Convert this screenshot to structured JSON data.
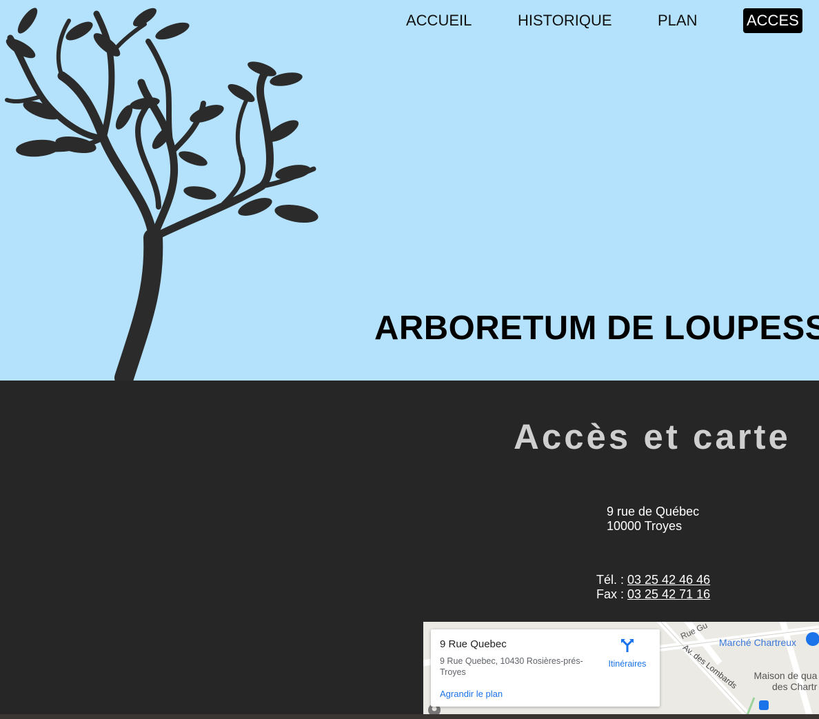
{
  "nav": {
    "items": [
      {
        "label": "ACCUEIL"
      },
      {
        "label": "HISTORIQUE"
      },
      {
        "label": "PLAN"
      },
      {
        "label": "ACCES",
        "active": true
      }
    ]
  },
  "hero": {
    "title": "ARBORETUM DE LOUPESS",
    "background": "#b4e2fc",
    "tree_color": "#2b2b2b"
  },
  "access": {
    "title": "Accès et carte",
    "address_line1": "9 rue de Québec",
    "address_line2": "10000 Troyes",
    "tel_label": "Tél. : ",
    "tel_number": "03 25 42 46 46",
    "fax_label": "Fax : ",
    "fax_number": "03 25 42 71 16"
  },
  "map": {
    "place_name": "9 Rue Quebec",
    "place_address": "9 Rue Quebec, 10430 Rosières-prés-Troyes",
    "directions_label": "Itinéraires",
    "enlarge_label": "Agrandir le plan",
    "poi_1": "Marché Chartreux",
    "poi_2_line1": "Maison de qua",
    "poi_2_line2": "des Chartr",
    "street_1": "Av. des Lombards",
    "street_2": "Rue Gu",
    "link_color": "#1a73e8"
  }
}
